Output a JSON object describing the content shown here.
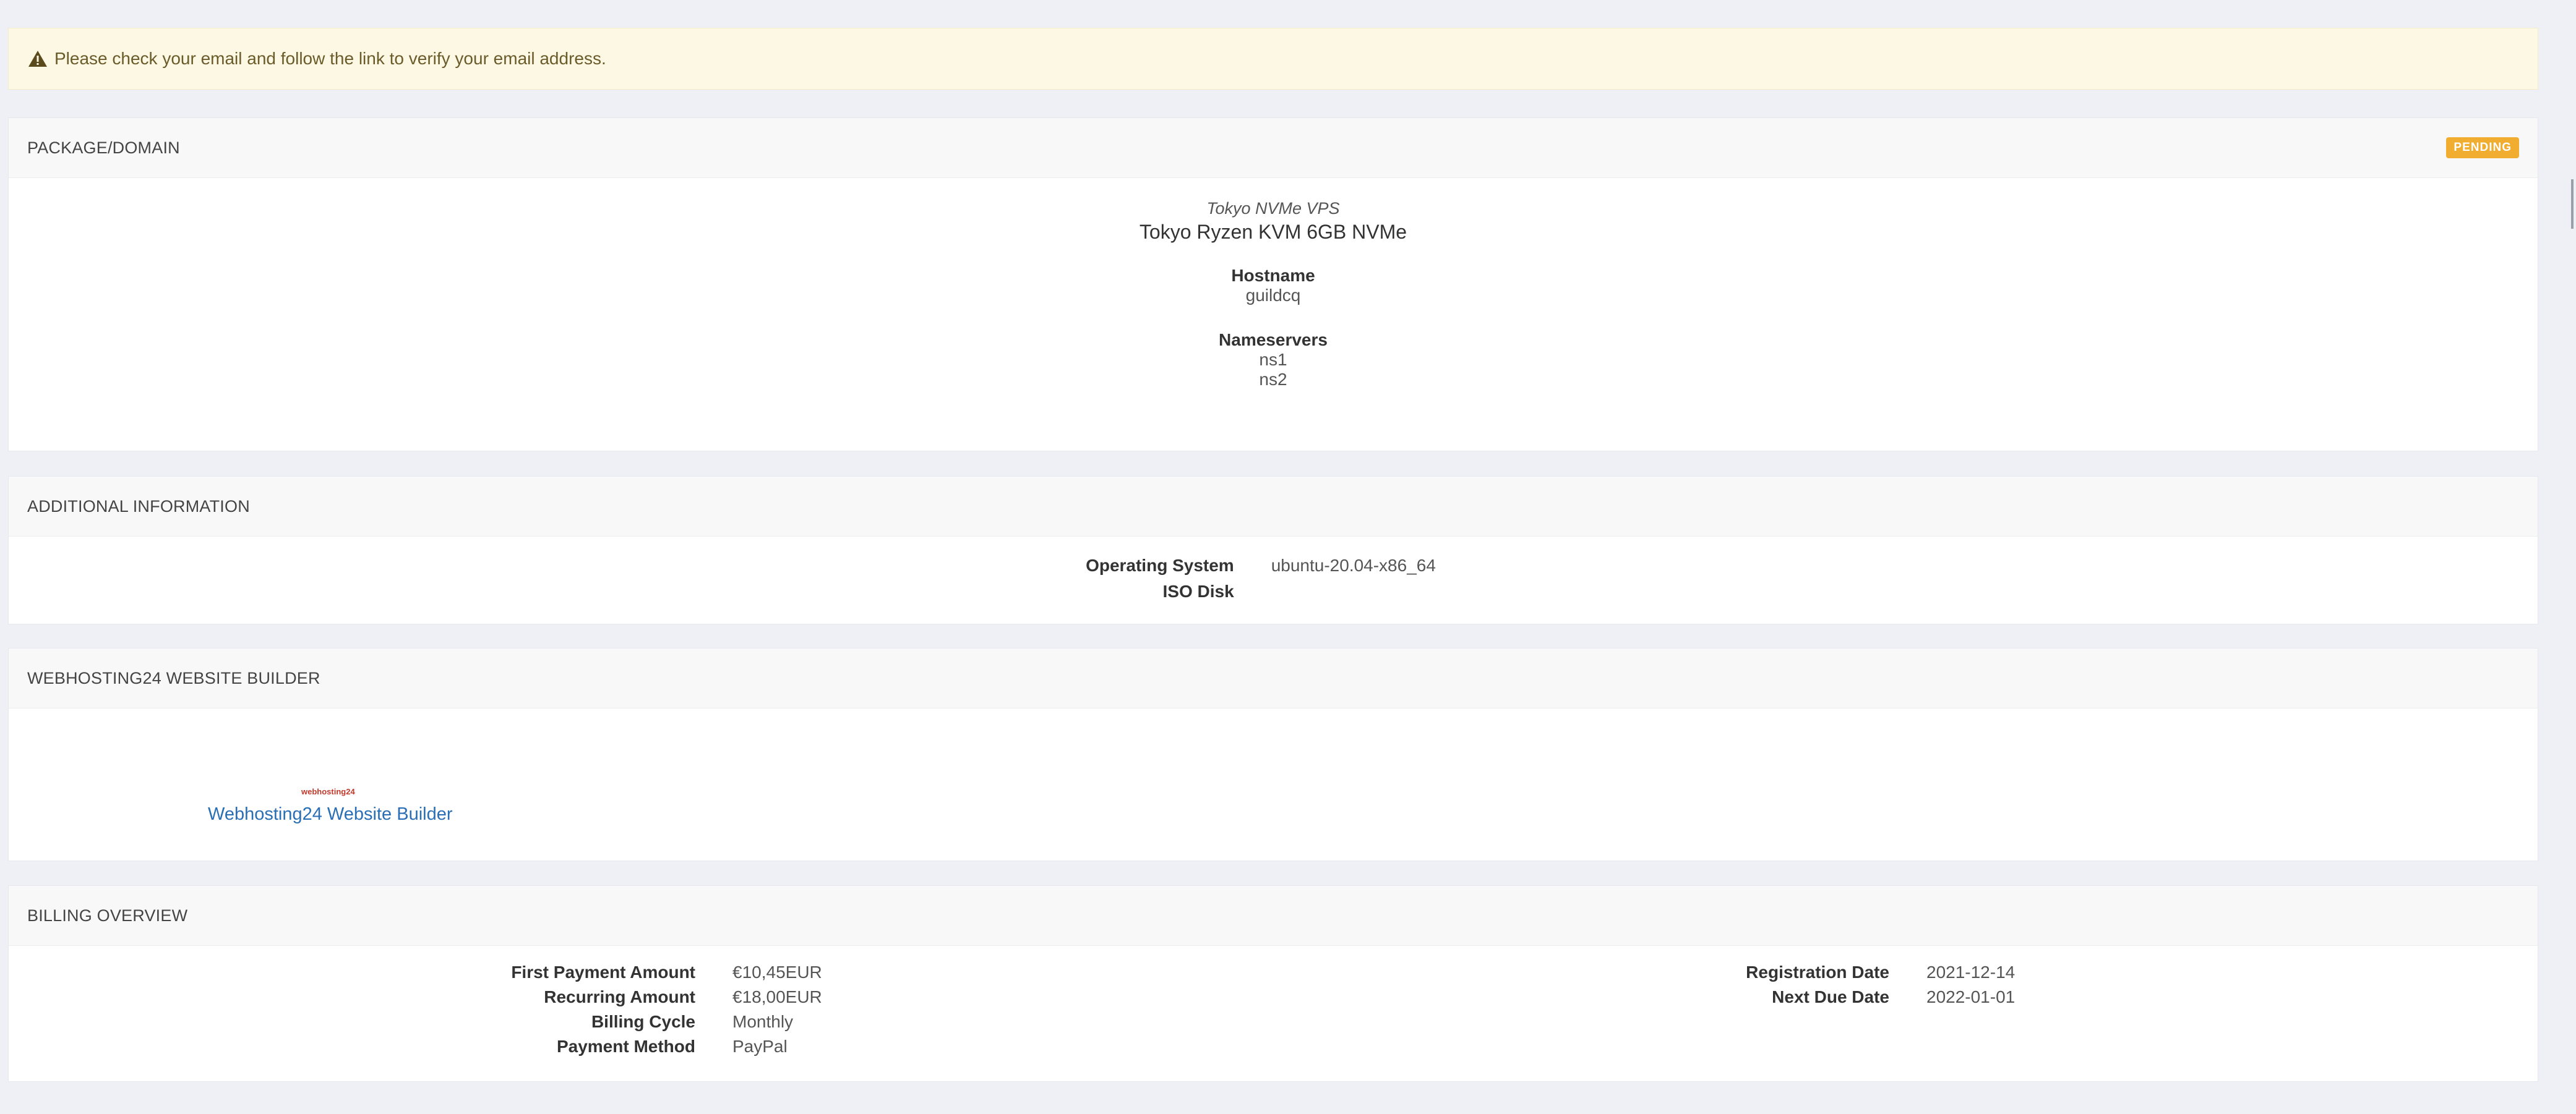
{
  "alert": {
    "text": "Please check your email and follow the link to verify your email address."
  },
  "package": {
    "header": "PACKAGE/DOMAIN",
    "status": "PENDING",
    "group": "Tokyo NVMe VPS",
    "product": "Tokyo Ryzen KVM 6GB NVMe",
    "hostname_label": "Hostname",
    "hostname": "guildcq",
    "nameservers_label": "Nameservers",
    "ns1": "ns1",
    "ns2": "ns2"
  },
  "additional": {
    "header": "ADDITIONAL INFORMATION",
    "os_label": "Operating System",
    "os_value": "ubuntu-20.04-x86_64",
    "iso_label": "ISO Disk",
    "iso_value": ""
  },
  "builder": {
    "header": "WEBHOSTING24 WEBSITE BUILDER",
    "logo_text": "webhosting24",
    "link_text": "Webhosting24 Website Builder"
  },
  "billing": {
    "header": "BILLING OVERVIEW",
    "left": [
      {
        "label": "First Payment Amount",
        "value": "€10,45EUR"
      },
      {
        "label": "Recurring Amount",
        "value": "€18,00EUR"
      },
      {
        "label": "Billing Cycle",
        "value": "Monthly"
      },
      {
        "label": "Payment Method",
        "value": "PayPal"
      }
    ],
    "right": [
      {
        "label": "Registration Date",
        "value": "2021-12-14"
      },
      {
        "label": "Next Due Date",
        "value": "2022-01-01"
      }
    ]
  },
  "colors": {
    "alert_bg": "#fcf8e3",
    "badge_pending": "#f0ad30",
    "link": "#2a6fb5"
  }
}
